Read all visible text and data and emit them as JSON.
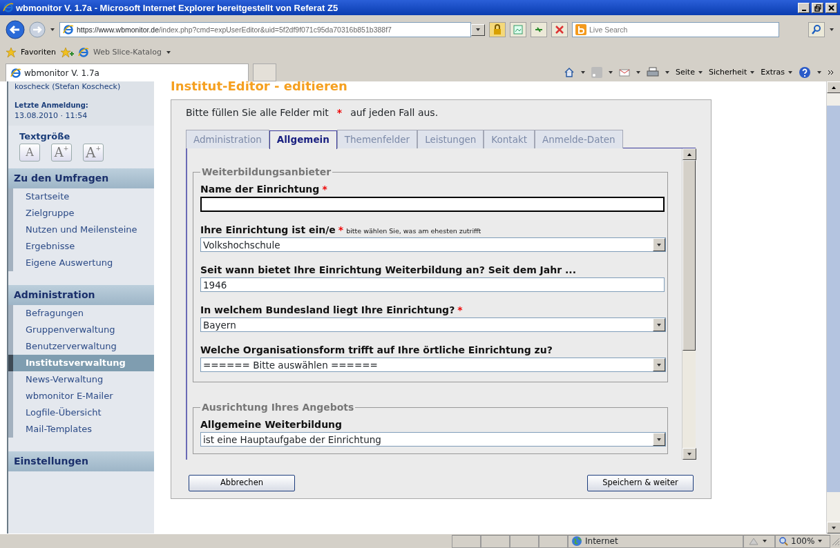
{
  "window": {
    "title": "wbmonitor V. 1.7a - Microsoft Internet Explorer bereitgestellt von Referat Z5"
  },
  "address_bar": {
    "url_host": "https://www.wbmonitor.de",
    "url_path": "/index.php?cmd=expUserEditor&uid=5f2df9f071c95da70316b851b388f7"
  },
  "search": {
    "placeholder": "Live Search"
  },
  "favorites_bar": {
    "favorites": "Favoriten",
    "web_slice": "Web Slice-Katalog"
  },
  "browser_tab": {
    "title": "wbmonitor V. 1.7a"
  },
  "command_bar": [
    "Seite",
    "Sicherheit",
    "Extras"
  ],
  "sidebar": {
    "user": "koscheck (Stefan Koscheck)",
    "last_login_label": "Letzte Anmeldung:",
    "last_login": "13.08.2010 · 11:54",
    "text_size_label": "Textgröße",
    "text_size_buttons": [
      "A",
      "A$^{+}$",
      "A$^{+}$"
    ],
    "sections": [
      {
        "title": "Zu den Umfragen",
        "items": [
          {
            "label": "Startseite",
            "selected": false
          },
          {
            "label": "Zielgruppe",
            "selected": false
          },
          {
            "label": "Nutzen und Meilensteine",
            "selected": false
          },
          {
            "label": "Ergebnisse",
            "selected": false
          },
          {
            "label": "Eigene Auswertung",
            "selected": false
          }
        ]
      },
      {
        "title": "Administration",
        "items": [
          {
            "label": "Befragungen",
            "selected": false
          },
          {
            "label": "Gruppenverwaltung",
            "selected": false
          },
          {
            "label": "Benutzerverwaltung",
            "selected": false
          },
          {
            "label": "Institutsverwaltung",
            "selected": true
          },
          {
            "label": "News-Verwaltung",
            "selected": false
          },
          {
            "label": "wbmonitor E-Mailer",
            "selected": false
          },
          {
            "label": "Logfile-Übersicht",
            "selected": false
          },
          {
            "label": "Mail-Templates",
            "selected": false
          }
        ]
      },
      {
        "title": "Einstellungen"
      }
    ]
  },
  "main": {
    "heading": "Institut-Editor - editieren",
    "note_before": "Bitte füllen Sie alle Felder mit",
    "note_marker": "*",
    "note_after": "auf jeden Fall aus.",
    "tabs": [
      {
        "label": "Administration",
        "selected": false
      },
      {
        "label": "Allgemein",
        "selected": true
      },
      {
        "label": "Themenfelder",
        "selected": false
      },
      {
        "label": "Leistungen",
        "selected": false
      },
      {
        "label": "Kontakt",
        "selected": false
      },
      {
        "label": "Anmelde-Daten",
        "selected": false
      }
    ],
    "fieldsets": [
      {
        "legend": "Weiterbildungsanbieter",
        "fields": [
          {
            "kind": "text",
            "label": "Name der Einrichtung",
            "required_mark": "*",
            "focused": true
          },
          {
            "kind": "select",
            "label": "Ihre Einrichtung ist ein/e",
            "required_mark": "*",
            "hint": "bitte wählen Sie, was am ehesten zutrifft",
            "value": "Volkshochschule"
          },
          {
            "kind": "text",
            "label": "Seit wann bietet Ihre Einrichtung Weiterbildung an? Seit dem Jahr ...",
            "value": "1946",
            "focused": false
          },
          {
            "kind": "select",
            "label": "In welchem Bundesland liegt Ihre Einrichtung?",
            "required_mark": "*",
            "value": "Bayern"
          },
          {
            "kind": "select",
            "label": "Welche Organisationsform trifft auf Ihre örtliche Einrichtung zu?",
            "value": "====== Bitte auswählen ======"
          }
        ]
      },
      {
        "legend": "Ausrichtung Ihres Angebots",
        "fields": [
          {
            "kind": "select",
            "label": "Allgemeine Weiterbildung",
            "value": "ist eine Hauptaufgabe der Einrichtung"
          }
        ]
      }
    ],
    "cancel_button": "Abbrechen",
    "save_button": "Speichern & weiter"
  },
  "status_bar": {
    "zone": "Internet",
    "zoom": "100%"
  }
}
